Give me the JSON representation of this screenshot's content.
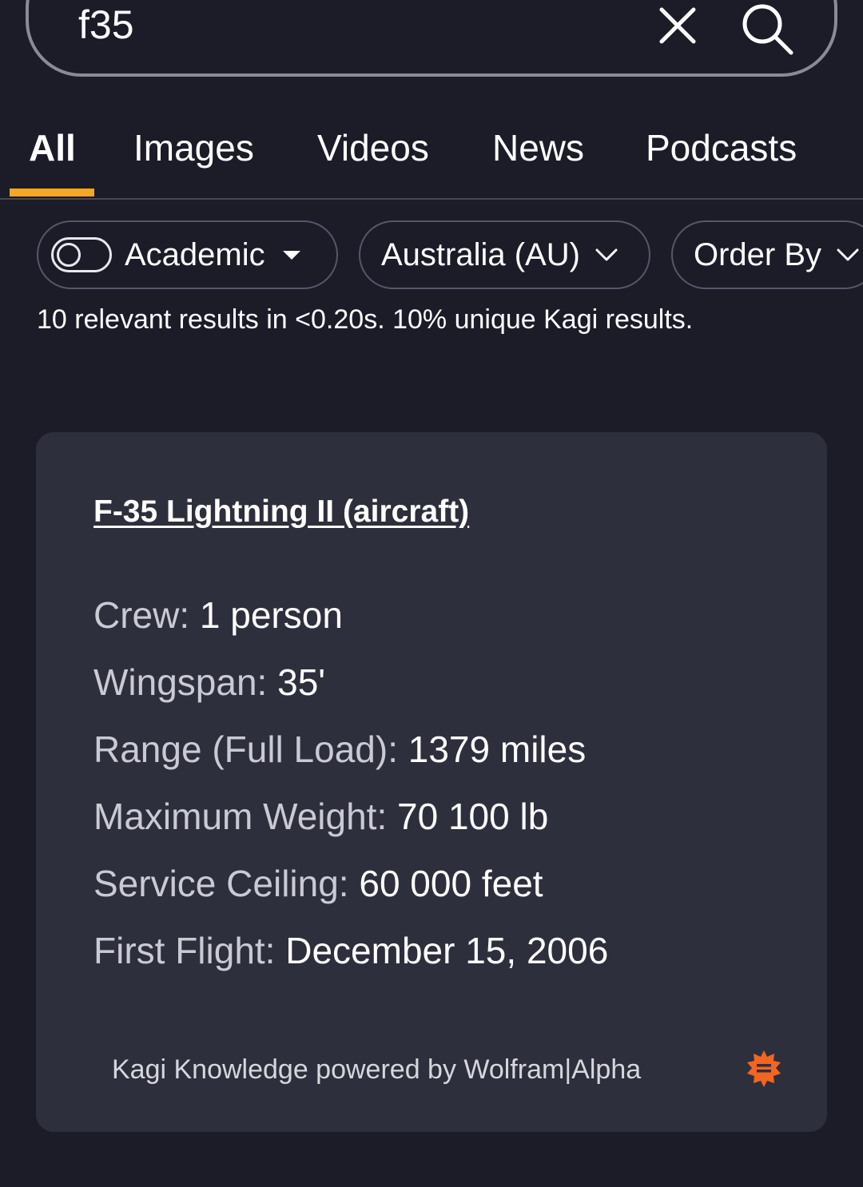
{
  "search": {
    "query": "f35"
  },
  "tabs": [
    {
      "label": "All",
      "active": true
    },
    {
      "label": "Images",
      "active": false
    },
    {
      "label": "Videos",
      "active": false
    },
    {
      "label": "News",
      "active": false
    },
    {
      "label": "Podcasts",
      "active": false
    }
  ],
  "filters": {
    "academic": {
      "label": "Academic",
      "enabled": false
    },
    "region": {
      "label": "Australia (AU)"
    },
    "order": {
      "label": "Order By"
    }
  },
  "stats": "10 relevant results in <0.20s. 10% unique Kagi results.",
  "knowledge": {
    "title": "F-35 Lightning II (aircraft)",
    "facts": [
      {
        "key": "Crew:",
        "value": "1 person"
      },
      {
        "key": "Wingspan:",
        "value": "35'"
      },
      {
        "key": "Range (Full Load):",
        "value": "1379 miles"
      },
      {
        "key": "Maximum Weight:",
        "value": "70 100 lb"
      },
      {
        "key": "Service Ceiling:",
        "value": "60 000 feet"
      },
      {
        "key": "First Flight:",
        "value": "December 15, 2006"
      }
    ],
    "footer": "Kagi Knowledge powered by Wolfram|Alpha"
  },
  "colors": {
    "background": "#1b1c28",
    "card": "#2e2f3c",
    "accent": "#f5a623",
    "wolfram": "#f26522"
  },
  "icons": {
    "clear": "close-icon",
    "search": "search-icon",
    "wolfram": "wolfram-alpha-icon"
  }
}
